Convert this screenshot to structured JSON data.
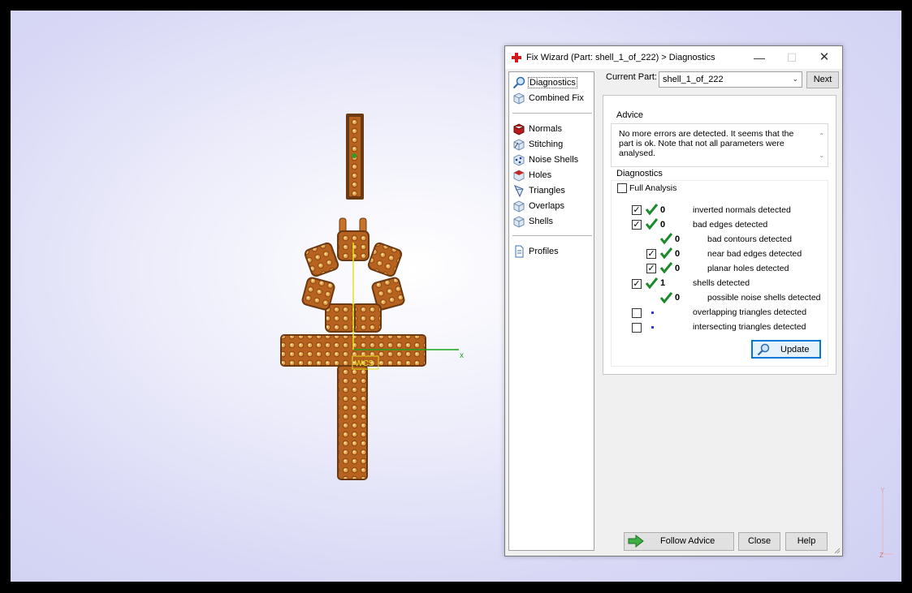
{
  "dialog": {
    "title": "Fix Wizard (Part: shell_1_of_222) > Diagnostics",
    "controls": {
      "minimize": "—",
      "maximize": "☐",
      "close": "✕"
    }
  },
  "nav": {
    "top_items": [
      {
        "label": "Diagnostics",
        "icon": "magnifier-icon"
      },
      {
        "label": "Combined Fix",
        "icon": "cube-icon"
      }
    ],
    "fix_items": [
      {
        "label": "Normals",
        "icon": "normals-cube-icon"
      },
      {
        "label": "Stitching",
        "icon": "stitching-cube-icon"
      },
      {
        "label": "Noise Shells",
        "icon": "noise-shells-icon"
      },
      {
        "label": "Holes",
        "icon": "holes-cube-icon"
      },
      {
        "label": "Triangles",
        "icon": "triangles-icon"
      },
      {
        "label": "Overlaps",
        "icon": "overlaps-cube-icon"
      },
      {
        "label": "Shells",
        "icon": "shells-cube-icon"
      }
    ],
    "profiles": {
      "label": "Profiles",
      "icon": "document-icon"
    }
  },
  "current_part": {
    "label": "Current Part:",
    "value": "shell_1_of_222",
    "next": "Next"
  },
  "advice": {
    "title": "Advice",
    "text": "No more errors are detected. It seems that the part is ok. Note that not all parameters were analysed."
  },
  "diagnostics": {
    "title": "Diagnostics",
    "full_analysis": {
      "label": "Full Analysis",
      "checked": false
    },
    "rows": [
      {
        "checkbox": true,
        "checked": true,
        "status": "ok",
        "count": "0",
        "label": "inverted normals detected",
        "indent": 0
      },
      {
        "checkbox": true,
        "checked": true,
        "status": "ok",
        "count": "0",
        "label": "bad edges detected",
        "indent": 0
      },
      {
        "checkbox": false,
        "checked": false,
        "status": "ok",
        "count": "0",
        "label": "bad contours detected",
        "indent": 1
      },
      {
        "checkbox": true,
        "checked": true,
        "status": "ok",
        "count": "0",
        "label": "near bad edges detected",
        "indent": 1
      },
      {
        "checkbox": true,
        "checked": true,
        "status": "ok",
        "count": "0",
        "label": "planar holes detected",
        "indent": 1
      },
      {
        "checkbox": true,
        "checked": true,
        "status": "ok",
        "count": "1",
        "label": "shells detected",
        "indent": 0
      },
      {
        "checkbox": false,
        "checked": false,
        "status": "ok",
        "count": "0",
        "label": "possible noise shells detected",
        "indent": 1
      },
      {
        "checkbox": true,
        "checked": false,
        "status": "none",
        "count": "",
        "label": "overlapping triangles detected",
        "indent": 0
      },
      {
        "checkbox": true,
        "checked": false,
        "status": "none",
        "count": "",
        "label": "intersecting triangles detected",
        "indent": 0
      }
    ],
    "update": "Update"
  },
  "buttons": {
    "follow_advice": "Follow Advice",
    "close": "Close",
    "help": "Help"
  },
  "viewport": {
    "axis_label_x": "x",
    "axis_label_y": "Y",
    "axis_label_z": "Z",
    "corner_y": "Y",
    "corner_z": "Z",
    "wcs_label": "WCS"
  },
  "colors": {
    "background_light": "#ffffff",
    "background_blue": "#cfcff2",
    "model_orange": "#c8732a",
    "model_dark": "#6b3a12",
    "gem": "#e8c07a",
    "axis_x": "#1aa21a",
    "axis_y": "#e3e31a",
    "tick_green": "#1a8a2a",
    "title_icon_red": "#d21a1a"
  }
}
